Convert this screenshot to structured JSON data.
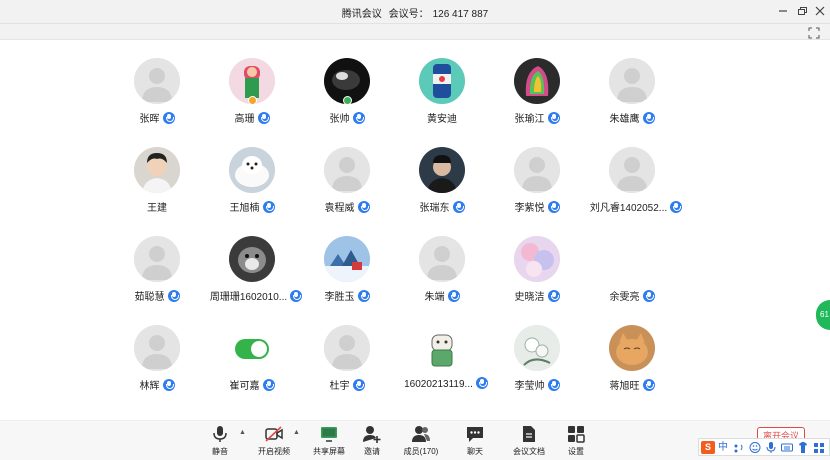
{
  "window": {
    "app_name": "腾讯会议",
    "meeting_label": "会议号：",
    "meeting_id": "126 417 887",
    "minimize_icon": "minimize-icon",
    "restore_icon": "restore-icon",
    "close_icon": "close-icon"
  },
  "participants": [
    {
      "name": "张晖",
      "avatar": "placeholder",
      "mic": true
    },
    {
      "name": "高珊",
      "avatar": "photo-pink",
      "mic": true,
      "host_dot": "#f2a72b"
    },
    {
      "name": "张帅",
      "avatar": "photo-dark",
      "mic": true,
      "host_dot": "#3ab05a"
    },
    {
      "name": "黄安迪",
      "avatar": "photo-can",
      "mic": false
    },
    {
      "name": "张瑜江",
      "avatar": "photo-colorful",
      "mic": true
    },
    {
      "name": "朱雄鹰",
      "avatar": "placeholder",
      "mic": true
    },
    {
      "name": "王建",
      "avatar": "photo-man",
      "mic": false
    },
    {
      "name": "王旭楠",
      "avatar": "photo-dog-white",
      "mic": true
    },
    {
      "name": "袁程威",
      "avatar": "placeholder",
      "mic": true
    },
    {
      "name": "张瑞东",
      "avatar": "photo-man-dark",
      "mic": true
    },
    {
      "name": "李紫悦",
      "avatar": "placeholder",
      "mic": true
    },
    {
      "name": "刘凡睿1402052...",
      "avatar": "placeholder",
      "mic": true
    },
    {
      "name": "茹聪慧",
      "avatar": "placeholder",
      "mic": true
    },
    {
      "name": "周珊珊1602010...",
      "avatar": "photo-dog-gray",
      "mic": true
    },
    {
      "name": "李胜玉",
      "avatar": "photo-winter",
      "mic": true
    },
    {
      "name": "朱端",
      "avatar": "placeholder",
      "mic": true
    },
    {
      "name": "史晓洁",
      "avatar": "photo-pastel",
      "mic": true
    },
    {
      "name": "余雯亮",
      "avatar": "none",
      "mic": true
    },
    {
      "name": "林辉",
      "avatar": "placeholder",
      "mic": true
    },
    {
      "name": "崔可嘉",
      "avatar": "toggle",
      "mic": true
    },
    {
      "name": "杜宇",
      "avatar": "placeholder",
      "mic": true
    },
    {
      "name": "16020213119...",
      "avatar": "photo-cartoon",
      "mic": true
    },
    {
      "name": "李莹帅",
      "avatar": "photo-flower",
      "mic": true
    },
    {
      "name": "蒋旭旺",
      "avatar": "photo-cat",
      "mic": true
    }
  ],
  "side_tab": {
    "label": "61"
  },
  "toolbar": {
    "mute": "静音",
    "video": "开启视频",
    "share": "共享屏幕",
    "invite": "邀请",
    "members": "成员(170)",
    "chat": "聊天",
    "docs": "会议文档",
    "settings": "设置"
  },
  "leave_button": "离开会议",
  "ime": {
    "logo": "S",
    "mode": "中"
  },
  "colors": {
    "accent": "#2d7cf0",
    "leave": "#e04848",
    "toggle_on": "#34b34a"
  }
}
